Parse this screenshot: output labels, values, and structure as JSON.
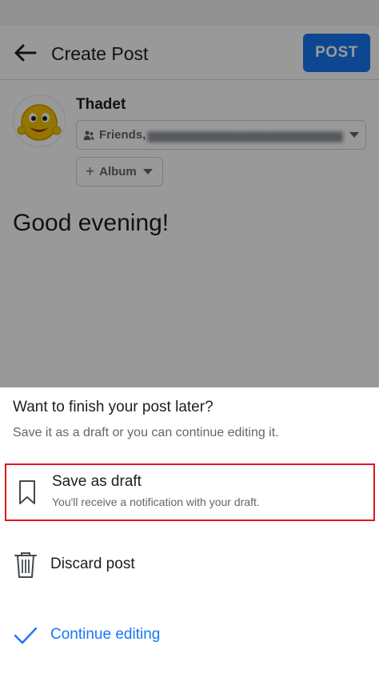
{
  "topbar": {
    "back_icon": "arrow-left-icon",
    "title": "Create Post",
    "post_label": "POST",
    "accent": "#1877f2"
  },
  "composer": {
    "user_name": "Thadet",
    "avatar_icon": "emoji-avatar",
    "audience_label": "Friends,",
    "audience_icon": "friends-icon",
    "album_label": "Album",
    "album_icon": "plus-icon",
    "text": "Good evening!"
  },
  "sheet": {
    "title": "Want to finish your post later?",
    "subtitle": "Save it as a draft or you can continue editing it.",
    "options": [
      {
        "label": "Save as draft",
        "description": "You'll receive a notification with your draft.",
        "icon": "bookmark-icon",
        "highlight": "#e0141e"
      },
      {
        "label": "Discard post",
        "icon": "trash-icon"
      },
      {
        "label": "Continue editing",
        "icon": "checkmark-icon",
        "color": "#1877f2"
      }
    ]
  }
}
